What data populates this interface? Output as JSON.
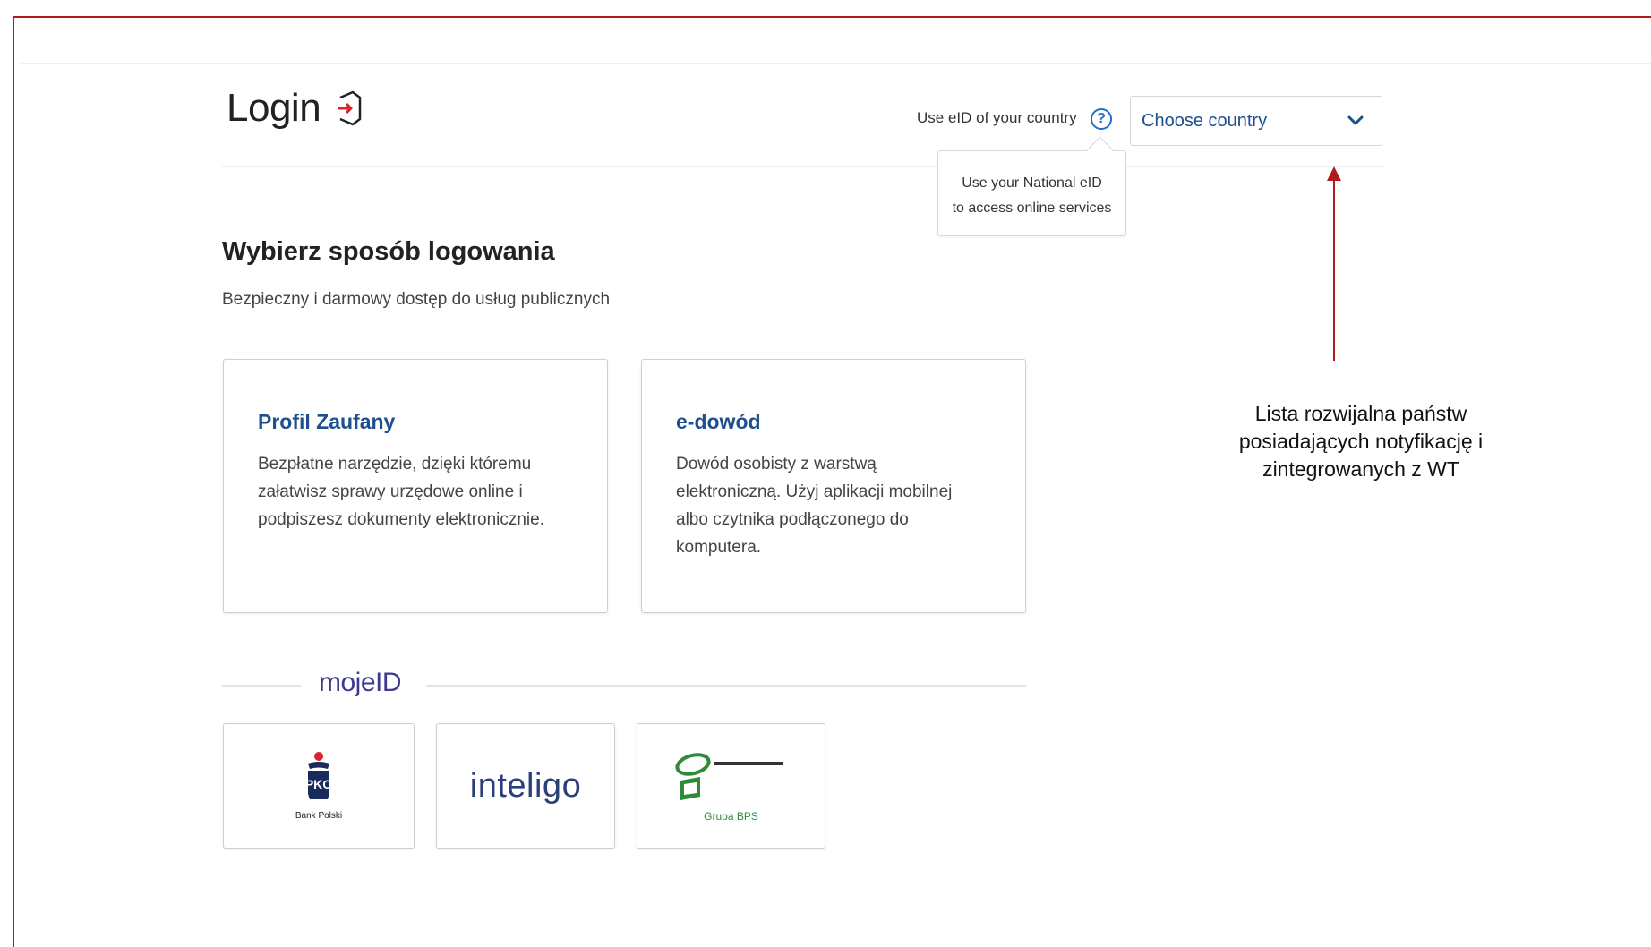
{
  "header": {
    "title": "Login",
    "eid_label": "Use eID of your country",
    "help_symbol": "?",
    "country_select": {
      "placeholder": "Choose country"
    },
    "tooltip": {
      "line1": "Use your National eID",
      "line2": "to access online services"
    }
  },
  "main": {
    "heading": "Wybierz sposób logowania",
    "subheading": "Bezpieczny i darmowy dostęp do usług publicznych",
    "cards": [
      {
        "title": "Profil Zaufany",
        "description": "Bezpłatne narzędzie, dzięki któremu załatwisz sprawy urzędowe online i podpiszesz dokumenty elektronicznie."
      },
      {
        "title": "e-dowód",
        "description": "Dowód osobisty z warstwą elektroniczną. Użyj aplikacji mobilnej albo czytnika podłączonego do komputera."
      }
    ],
    "mojeid": {
      "logo": "mojeID",
      "banks": [
        {
          "name": "Bank Polski",
          "icon": "pko-logo-icon"
        },
        {
          "name": "inteligo",
          "icon": "inteligo-logo"
        },
        {
          "name": "Grupa BPS",
          "icon": "bps-logo-icon"
        }
      ]
    }
  },
  "annotation": {
    "text": "Lista rozwijalna państw posiadających notyfikację i zintegrowanych z WT"
  },
  "colors": {
    "frame": "#b01b1b",
    "link_blue": "#1e4f8f",
    "help_blue": "#1f6ec7",
    "mojeid_purple": "#3d3a8f",
    "bps_green": "#2e8b3a"
  }
}
